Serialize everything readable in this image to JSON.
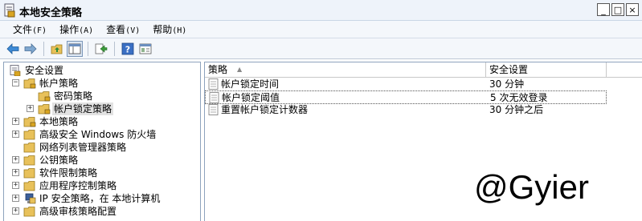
{
  "window": {
    "title": "本地安全策略",
    "controls": [
      "_",
      "□",
      "×"
    ]
  },
  "menubar": [
    {
      "label": "文件",
      "hotkey": "(F)"
    },
    {
      "label": "操作",
      "hotkey": "(A)"
    },
    {
      "label": "查看",
      "hotkey": "(V)"
    },
    {
      "label": "帮助",
      "hotkey": "(H)"
    }
  ],
  "toolbar": {
    "icons": [
      "back-arrow-icon",
      "forward-arrow-icon",
      "up-folder-icon",
      "show-hide-tree-icon",
      "export-list-icon",
      "help-icon",
      "properties-icon"
    ]
  },
  "tree": {
    "root": "安全设置",
    "items": [
      {
        "label": "帐户策略",
        "expander": "−"
      },
      {
        "label": "密码策略",
        "expander": ""
      },
      {
        "label": "帐户锁定策略",
        "expander": "+"
      },
      {
        "label": "本地策略",
        "expander": "+"
      },
      {
        "label": "高级安全 Windows 防火墙",
        "expander": "+"
      },
      {
        "label": "网络列表管理器策略",
        "expander": ""
      },
      {
        "label": "公钥策略",
        "expander": "+"
      },
      {
        "label": "软件限制策略",
        "expander": "+"
      },
      {
        "label": "应用程序控制策略",
        "expander": "+"
      },
      {
        "label": "IP 安全策略，在 本地计算机",
        "expander": "+"
      },
      {
        "label": "高级审核策略配置",
        "expander": "+"
      }
    ]
  },
  "list": {
    "columns": [
      "策略",
      "安全设置"
    ],
    "rows": [
      {
        "policy": "帐户锁定时间",
        "setting": "30 分钟"
      },
      {
        "policy": "帐户锁定阈值",
        "setting": "5 次无效登录"
      },
      {
        "policy": "重置帐户锁定计数器",
        "setting": "30 分钟之后"
      }
    ]
  },
  "watermark": "@Gyier",
  "colors": {
    "titlebar": "#eef3fa",
    "folder": "#e8c15a",
    "selection": "#e2e2e2",
    "pane_border": "#8ea3bd"
  }
}
